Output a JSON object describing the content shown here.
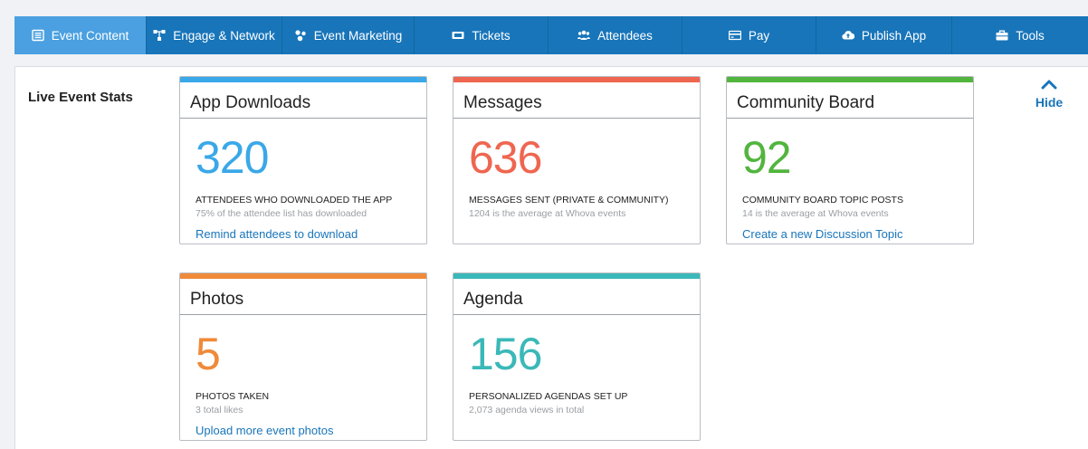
{
  "nav": {
    "items": [
      {
        "label": "Event Content",
        "icon": "list-icon"
      },
      {
        "label": "Engage & Network",
        "icon": "network-icon"
      },
      {
        "label": "Event Marketing",
        "icon": "share-icon"
      },
      {
        "label": "Tickets",
        "icon": "ticket-icon"
      },
      {
        "label": "Attendees",
        "icon": "users-icon"
      },
      {
        "label": "Pay",
        "icon": "card-icon"
      },
      {
        "label": "Publish App",
        "icon": "cloud-upload-icon"
      },
      {
        "label": "Tools",
        "icon": "toolbox-icon"
      }
    ],
    "active_color": "#4aa0e0",
    "bar_color": "#1875ba"
  },
  "panel": {
    "title": "Live Event Stats",
    "hide_label": "Hide"
  },
  "cards": [
    {
      "title": "App Downloads",
      "value": "320",
      "label": "ATTENDEES WHO DOWNLOADED THE APP",
      "sub": "75% of the attendee list has downloaded",
      "link": "Remind attendees to download",
      "color": "#3aa8e8"
    },
    {
      "title": "Messages",
      "value": "636",
      "label": "MESSAGES SENT (PRIVATE & COMMUNITY)",
      "sub": "1204 is the average at Whova events",
      "link": "",
      "color": "#ef6650"
    },
    {
      "title": "Community Board",
      "value": "92",
      "label": "COMMUNITY BOARD TOPIC POSTS",
      "sub": "14 is the average at Whova events",
      "link": "Create a new Discussion Topic",
      "color": "#52b53e"
    },
    {
      "title": "Photos",
      "value": "5",
      "label": "PHOTOS TAKEN",
      "sub": "3 total likes",
      "link": "Upload more event photos",
      "color": "#ef8a3a"
    },
    {
      "title": "Agenda",
      "value": "156",
      "label": "PERSONALIZED AGENDAS SET UP",
      "sub": "2,073 agenda views in total",
      "link": "",
      "color": "#3bb8b8"
    }
  ]
}
